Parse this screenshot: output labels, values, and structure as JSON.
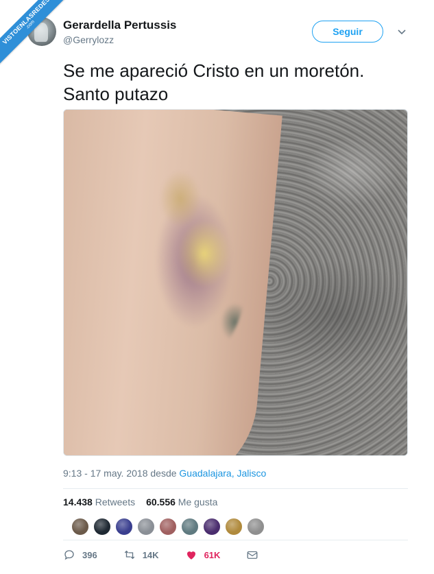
{
  "watermark": {
    "line1": "VISTOENLASREDES",
    "line2": ".com"
  },
  "tweet": {
    "author": {
      "name": "Gerardella Pertussis",
      "handle": "@Gerrylozz"
    },
    "follow_label": "Seguir",
    "text": "Se me apareció Cristo en un moretón.\nSanto putazo",
    "time": "9:13 - 17 may. 2018 desde ",
    "location": "Guadalajara, Jalisco",
    "stats": {
      "retweets_count": "14.438",
      "retweets_label": "Retweets",
      "likes_count": "60.556",
      "likes_label": "Me gusta"
    },
    "liker_colors": [
      "#6b5a4a",
      "#1f2933",
      "#3a3f8f",
      "#8a8f96",
      "#a06060",
      "#5f7a80",
      "#4a2d6e",
      "#b08a3c",
      "#8f8f8f"
    ],
    "actions": {
      "reply_count": "396",
      "retweet_count": "14K",
      "like_count": "61K"
    },
    "colors": {
      "accent": "#1da1f2",
      "like": "#e0245e",
      "muted": "#657786"
    }
  }
}
